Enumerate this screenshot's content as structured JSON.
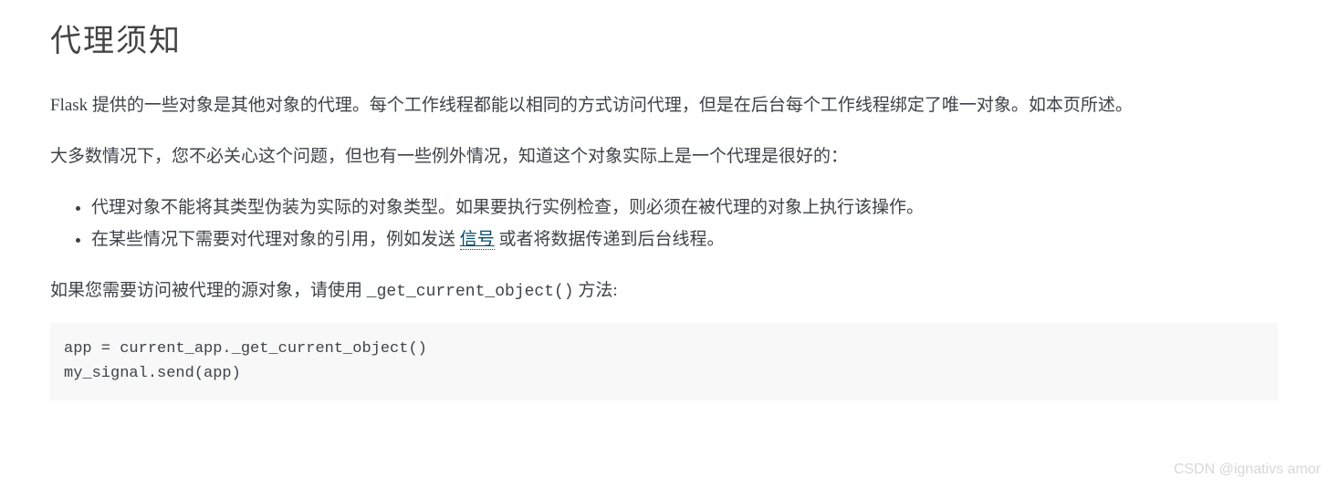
{
  "heading": "代理须知",
  "para1": "Flask 提供的一些对象是其他对象的代理。每个工作线程都能以相同的方式访问代理，但是在后台每个工作线程绑定了唯一对象。如本页所述。",
  "para2": "大多数情况下，您不必关心这个问题，但也有一些例外情况，知道这个对象实际上是一个代理是很好的：",
  "list": {
    "item1": "代理对象不能将其类型伪装为实际的对象类型。如果要执行实例检查，则必须在被代理的对象上执行该操作。",
    "item2_prefix": "在某些情况下需要对代理对象的引用，例如发送 ",
    "item2_link": "信号",
    "item2_suffix": " 或者将数据传递到后台线程。"
  },
  "para3_prefix": "如果您需要访问被代理的源对象，请使用 ",
  "para3_code": "_get_current_object()",
  "para3_suffix": " 方法:",
  "code_block": "app = current_app._get_current_object()\nmy_signal.send(app)",
  "watermark": "CSDN @ignativs  amor"
}
